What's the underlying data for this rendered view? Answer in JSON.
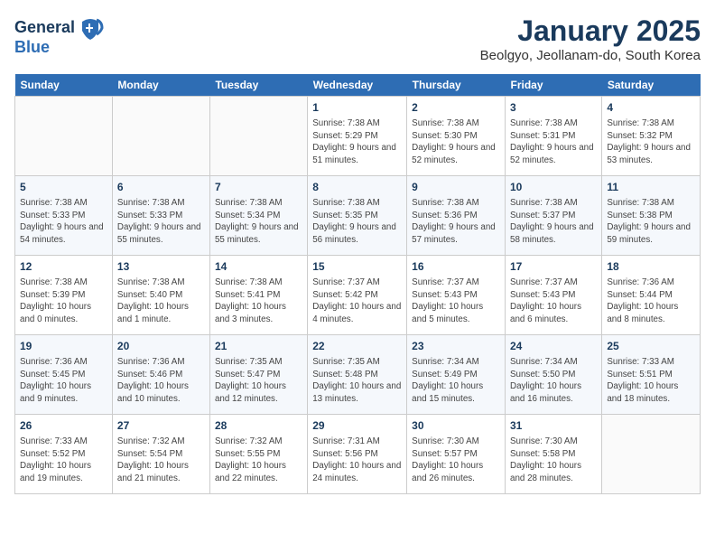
{
  "header": {
    "logo_line1": "General",
    "logo_line2": "Blue",
    "month_title": "January 2025",
    "location": "Beolgyo, Jeollanam-do, South Korea"
  },
  "days_header": [
    "Sunday",
    "Monday",
    "Tuesday",
    "Wednesday",
    "Thursday",
    "Friday",
    "Saturday"
  ],
  "weeks": [
    [
      {
        "day": "",
        "info": ""
      },
      {
        "day": "",
        "info": ""
      },
      {
        "day": "",
        "info": ""
      },
      {
        "day": "1",
        "info": "Sunrise: 7:38 AM\nSunset: 5:29 PM\nDaylight: 9 hours\nand 51 minutes."
      },
      {
        "day": "2",
        "info": "Sunrise: 7:38 AM\nSunset: 5:30 PM\nDaylight: 9 hours\nand 52 minutes."
      },
      {
        "day": "3",
        "info": "Sunrise: 7:38 AM\nSunset: 5:31 PM\nDaylight: 9 hours\nand 52 minutes."
      },
      {
        "day": "4",
        "info": "Sunrise: 7:38 AM\nSunset: 5:32 PM\nDaylight: 9 hours\nand 53 minutes."
      }
    ],
    [
      {
        "day": "5",
        "info": "Sunrise: 7:38 AM\nSunset: 5:33 PM\nDaylight: 9 hours\nand 54 minutes."
      },
      {
        "day": "6",
        "info": "Sunrise: 7:38 AM\nSunset: 5:33 PM\nDaylight: 9 hours\nand 55 minutes."
      },
      {
        "day": "7",
        "info": "Sunrise: 7:38 AM\nSunset: 5:34 PM\nDaylight: 9 hours\nand 55 minutes."
      },
      {
        "day": "8",
        "info": "Sunrise: 7:38 AM\nSunset: 5:35 PM\nDaylight: 9 hours\nand 56 minutes."
      },
      {
        "day": "9",
        "info": "Sunrise: 7:38 AM\nSunset: 5:36 PM\nDaylight: 9 hours\nand 57 minutes."
      },
      {
        "day": "10",
        "info": "Sunrise: 7:38 AM\nSunset: 5:37 PM\nDaylight: 9 hours\nand 58 minutes."
      },
      {
        "day": "11",
        "info": "Sunrise: 7:38 AM\nSunset: 5:38 PM\nDaylight: 9 hours\nand 59 minutes."
      }
    ],
    [
      {
        "day": "12",
        "info": "Sunrise: 7:38 AM\nSunset: 5:39 PM\nDaylight: 10 hours\nand 0 minutes."
      },
      {
        "day": "13",
        "info": "Sunrise: 7:38 AM\nSunset: 5:40 PM\nDaylight: 10 hours\nand 1 minute."
      },
      {
        "day": "14",
        "info": "Sunrise: 7:38 AM\nSunset: 5:41 PM\nDaylight: 10 hours\nand 3 minutes."
      },
      {
        "day": "15",
        "info": "Sunrise: 7:37 AM\nSunset: 5:42 PM\nDaylight: 10 hours\nand 4 minutes."
      },
      {
        "day": "16",
        "info": "Sunrise: 7:37 AM\nSunset: 5:43 PM\nDaylight: 10 hours\nand 5 minutes."
      },
      {
        "day": "17",
        "info": "Sunrise: 7:37 AM\nSunset: 5:43 PM\nDaylight: 10 hours\nand 6 minutes."
      },
      {
        "day": "18",
        "info": "Sunrise: 7:36 AM\nSunset: 5:44 PM\nDaylight: 10 hours\nand 8 minutes."
      }
    ],
    [
      {
        "day": "19",
        "info": "Sunrise: 7:36 AM\nSunset: 5:45 PM\nDaylight: 10 hours\nand 9 minutes."
      },
      {
        "day": "20",
        "info": "Sunrise: 7:36 AM\nSunset: 5:46 PM\nDaylight: 10 hours\nand 10 minutes."
      },
      {
        "day": "21",
        "info": "Sunrise: 7:35 AM\nSunset: 5:47 PM\nDaylight: 10 hours\nand 12 minutes."
      },
      {
        "day": "22",
        "info": "Sunrise: 7:35 AM\nSunset: 5:48 PM\nDaylight: 10 hours\nand 13 minutes."
      },
      {
        "day": "23",
        "info": "Sunrise: 7:34 AM\nSunset: 5:49 PM\nDaylight: 10 hours\nand 15 minutes."
      },
      {
        "day": "24",
        "info": "Sunrise: 7:34 AM\nSunset: 5:50 PM\nDaylight: 10 hours\nand 16 minutes."
      },
      {
        "day": "25",
        "info": "Sunrise: 7:33 AM\nSunset: 5:51 PM\nDaylight: 10 hours\nand 18 minutes."
      }
    ],
    [
      {
        "day": "26",
        "info": "Sunrise: 7:33 AM\nSunset: 5:52 PM\nDaylight: 10 hours\nand 19 minutes."
      },
      {
        "day": "27",
        "info": "Sunrise: 7:32 AM\nSunset: 5:54 PM\nDaylight: 10 hours\nand 21 minutes."
      },
      {
        "day": "28",
        "info": "Sunrise: 7:32 AM\nSunset: 5:55 PM\nDaylight: 10 hours\nand 22 minutes."
      },
      {
        "day": "29",
        "info": "Sunrise: 7:31 AM\nSunset: 5:56 PM\nDaylight: 10 hours\nand 24 minutes."
      },
      {
        "day": "30",
        "info": "Sunrise: 7:30 AM\nSunset: 5:57 PM\nDaylight: 10 hours\nand 26 minutes."
      },
      {
        "day": "31",
        "info": "Sunrise: 7:30 AM\nSunset: 5:58 PM\nDaylight: 10 hours\nand 28 minutes."
      },
      {
        "day": "",
        "info": ""
      }
    ]
  ]
}
